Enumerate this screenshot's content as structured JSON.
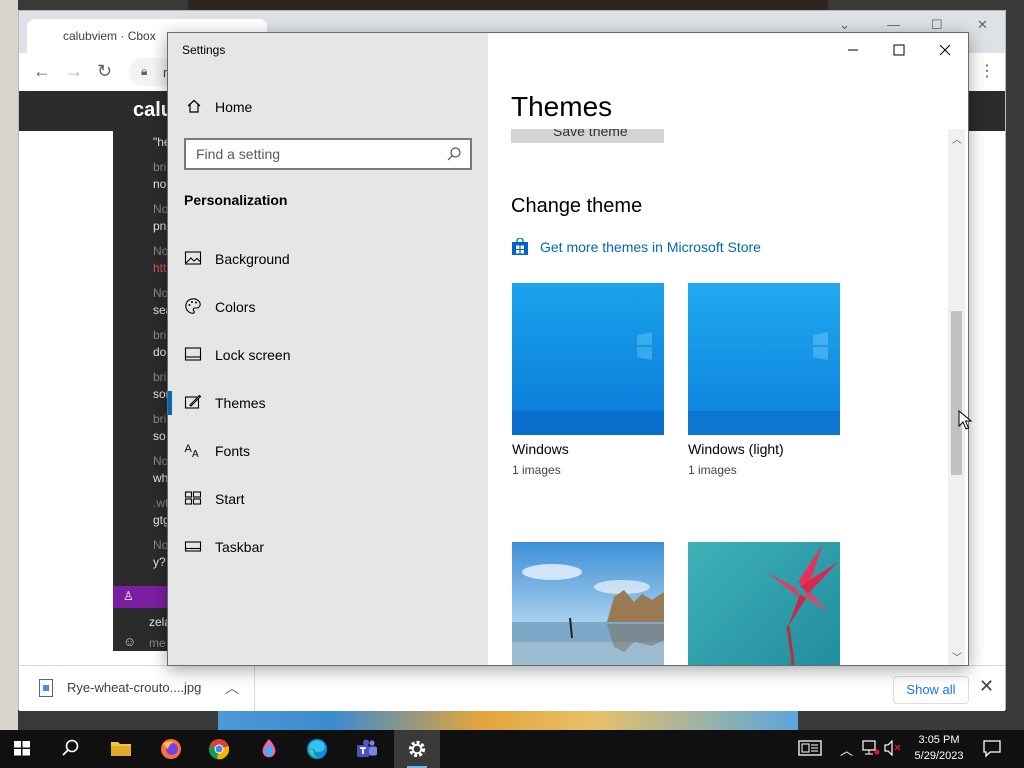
{
  "browser": {
    "tab_title": "calubviem · Cbox",
    "omnibox_text": "m",
    "site_title": "calu",
    "chat": [
      {
        "type": "msg",
        "text": "\"he"
      },
      {
        "type": "name",
        "text": "bri"
      },
      {
        "type": "msg",
        "text": "not"
      },
      {
        "type": "name",
        "text": "No"
      },
      {
        "type": "msg",
        "text": "pn"
      },
      {
        "type": "name",
        "text": "No"
      },
      {
        "type": "link",
        "text": "htt"
      },
      {
        "type": "name",
        "text": "No"
      },
      {
        "type": "msg",
        "text": "sea"
      },
      {
        "type": "name",
        "text": "bri"
      },
      {
        "type": "msg",
        "text": "do"
      },
      {
        "type": "name",
        "text": "bri"
      },
      {
        "type": "msg",
        "text": "sor"
      },
      {
        "type": "name",
        "text": "bri"
      },
      {
        "type": "msg",
        "text": "so"
      },
      {
        "type": "name",
        "text": "No"
      },
      {
        "type": "msg",
        "text": "wh"
      },
      {
        "type": "name",
        "text": ".wt"
      },
      {
        "type": "msg",
        "text": "gtg"
      },
      {
        "type": "name",
        "text": "No"
      },
      {
        "type": "msg",
        "text": "y?"
      }
    ],
    "chat_input_name": "zela",
    "chat_input_placeholder": "me",
    "download": {
      "filename": "Rye-wheat-crouto....jpg",
      "show_all": "Show all"
    }
  },
  "settings": {
    "window_title": "Settings",
    "home_label": "Home",
    "search_placeholder": "Find a setting",
    "section_heading": "Personalization",
    "nav_items": [
      {
        "label": "Background",
        "icon": "image-icon"
      },
      {
        "label": "Colors",
        "icon": "palette-icon"
      },
      {
        "label": "Lock screen",
        "icon": "lock-screen-icon"
      },
      {
        "label": "Themes",
        "icon": "brush-icon",
        "active": true
      },
      {
        "label": "Fonts",
        "icon": "font-icon"
      },
      {
        "label": "Start",
        "icon": "start-icon"
      },
      {
        "label": "Taskbar",
        "icon": "taskbar-icon"
      }
    ],
    "page_title": "Themes",
    "save_theme_label": "Save theme",
    "change_theme_heading": "Change theme",
    "store_link": "Get more themes in Microsoft Store",
    "themes": [
      {
        "name": "Windows",
        "count": "1 images",
        "style": "windows-dark"
      },
      {
        "name": "Windows (light)",
        "count": "1 images",
        "style": "windows-light"
      },
      {
        "name": "",
        "count": "",
        "style": "beach"
      },
      {
        "name": "",
        "count": "",
        "style": "flower"
      }
    ],
    "accent_color": "#0067c0"
  },
  "taskbar": {
    "apps": [
      "start-icon",
      "search-icon",
      "file-explorer-icon",
      "firefox-icon",
      "chrome-icon",
      "paint-icon",
      "edge-icon",
      "teams-icon",
      "settings-icon"
    ],
    "time": "3:05 PM",
    "date": "5/29/2023"
  }
}
